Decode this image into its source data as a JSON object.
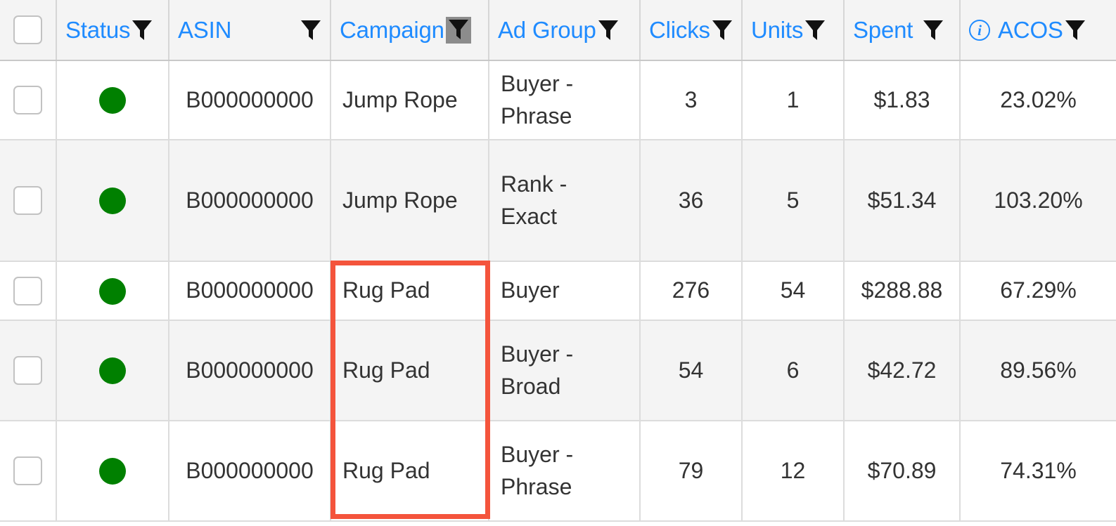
{
  "table": {
    "columns": [
      {
        "key": "checkbox",
        "label": "",
        "icon": "checkbox-icon",
        "filter": false,
        "align": "center"
      },
      {
        "key": "status",
        "label": "Status",
        "filter": true,
        "filter_highlighted": false,
        "align": "center"
      },
      {
        "key": "asin",
        "label": "ASIN",
        "filter": true,
        "filter_highlighted": false,
        "align": "center"
      },
      {
        "key": "campaign",
        "label": "Campaign",
        "filter": true,
        "filter_highlighted": true,
        "align": "left"
      },
      {
        "key": "adgroup",
        "label": "Ad Group",
        "filter": true,
        "filter_highlighted": false,
        "align": "left"
      },
      {
        "key": "clicks",
        "label": "Clicks",
        "filter": true,
        "filter_highlighted": false,
        "align": "center"
      },
      {
        "key": "units",
        "label": "Units",
        "filter": true,
        "filter_highlighted": false,
        "align": "center"
      },
      {
        "key": "spent",
        "label": "Spent",
        "filter": true,
        "filter_highlighted": false,
        "align": "center"
      },
      {
        "key": "acos",
        "label": "ACOS",
        "filter": true,
        "filter_highlighted": false,
        "align": "center",
        "info_icon": true,
        "info_glyph": "i"
      }
    ],
    "rows": [
      {
        "selected": false,
        "status": "active",
        "asin": "B000000000",
        "campaign": "Jump Rope",
        "adgroup": "Buyer - Phrase",
        "clicks": "3",
        "units": "1",
        "spent": "$1.83",
        "acos": "23.02%"
      },
      {
        "selected": false,
        "status": "active",
        "asin": "B000000000",
        "campaign": "Jump Rope",
        "adgroup": "Rank - Exact",
        "clicks": "36",
        "units": "5",
        "spent": "$51.34",
        "acos": "103.20%"
      },
      {
        "selected": false,
        "status": "active",
        "asin": "B000000000",
        "campaign": "Rug Pad",
        "adgroup": "Buyer",
        "clicks": "276",
        "units": "54",
        "spent": "$288.88",
        "acos": "67.29%"
      },
      {
        "selected": false,
        "status": "active",
        "asin": "B000000000",
        "campaign": "Rug Pad",
        "adgroup": "Buyer - Broad",
        "clicks": "54",
        "units": "6",
        "spent": "$42.72",
        "acos": "89.56%"
      },
      {
        "selected": false,
        "status": "active",
        "asin": "B000000000",
        "campaign": "Rug Pad",
        "adgroup": "Buyer - Phrase",
        "clicks": "79",
        "units": "12",
        "spent": "$70.89",
        "acos": "74.31%"
      }
    ]
  },
  "annotation": {
    "target_column": "campaign",
    "color": "#f4543c"
  },
  "colors": {
    "header_text": "#1f8bff",
    "header_background": "#f4f4f4",
    "row_alt_background": "#f4f4f4",
    "status_active": "#008000",
    "cell_text": "#333333",
    "grid_line": "#dcdcdc",
    "annotation": "#f4543c",
    "filter_highlight": "#8c8c8c"
  }
}
